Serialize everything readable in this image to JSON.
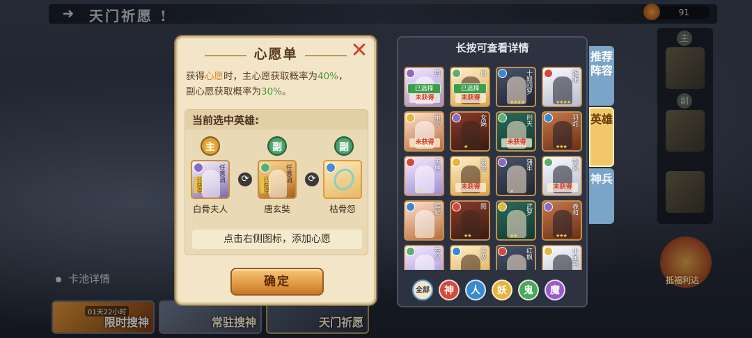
{
  "header": {
    "back_icon": "back-arrow-icon",
    "title": "天门祈愿 !",
    "currency_value": "91"
  },
  "pool_detail_label": "卡池详情",
  "bottom_tabs": [
    {
      "label": "限时搜神",
      "timer": "01天22小时"
    },
    {
      "label": "常驻搜神",
      "timer": ""
    },
    {
      "label": "天门祈愿",
      "timer": ""
    }
  ],
  "right_strip": {
    "badge_main": "主",
    "badge_sub": "副"
  },
  "treasure_label": "抵福利达",
  "wish_panel": {
    "title": "心愿单",
    "desc_line1_pre": "获得",
    "desc_line1_hl": "心愿",
    "desc_line1_mid": "时，主心愿获取概率为",
    "desc_line1_pct": "40%",
    "desc_line1_end": "，",
    "desc_line2_pre": "副心愿获取概率为",
    "desc_line2_pct": "30%",
    "desc_line2_end": "。",
    "selected_header": "当前选中英雄:",
    "slots": [
      {
        "role": "主",
        "name": "白骨夫人",
        "side_text": "任意消",
        "tag": "已获得"
      },
      {
        "role": "副",
        "name": "唐玄奘",
        "side_text": "任意消",
        "tag": "已获得"
      },
      {
        "role": "副",
        "name": "枯骨怨",
        "side_text": "",
        "tag": ""
      }
    ],
    "hint": "点击右侧图标，添加心愿",
    "confirm": "确定"
  },
  "hero_panel": {
    "title": "长按可查看详情",
    "cells": [
      {
        "name": "唐",
        "status": "已选择",
        "unowned": "未获得",
        "stars": ""
      },
      {
        "name": "白",
        "status": "已选择",
        "unowned": "未获得",
        "stars": ""
      },
      {
        "name": "十殿阎罗",
        "status": "",
        "unowned": "",
        "stars": "★★★★"
      },
      {
        "name": "嫦娥",
        "status": "",
        "unowned": "",
        "stars": "★★★★"
      },
      {
        "name": "蚩尤",
        "status": "",
        "unowned": "未获得",
        "stars": ""
      },
      {
        "name": "女娲",
        "status": "",
        "unowned": "",
        "stars": "★"
      },
      {
        "name": "刑天",
        "status": "",
        "unowned": "未获得",
        "stars": ""
      },
      {
        "name": "羽蛇",
        "status": "",
        "unowned": "",
        "stars": "★★★"
      },
      {
        "name": "天棒",
        "status": "",
        "unowned": "",
        "stars": "★"
      },
      {
        "name": "狻猊",
        "status": "",
        "unowned": "未获得",
        "stars": ""
      },
      {
        "name": "蒲牢",
        "status": "",
        "unowned": "",
        "stars": "★"
      },
      {
        "name": "嘲风",
        "status": "",
        "unowned": "未获得",
        "stars": ""
      },
      {
        "name": "睚眦",
        "status": "",
        "unowned": "",
        "stars": "★"
      },
      {
        "name": "图",
        "status": "",
        "unowned": "",
        "stars": "★★"
      },
      {
        "name": "武罗",
        "status": "",
        "unowned": "",
        "stars": "★★"
      },
      {
        "name": "羲和",
        "status": "",
        "unowned": "",
        "stars": "★★★"
      },
      {
        "name": "夸父",
        "status": "",
        "unowned": "",
        "stars": ""
      },
      {
        "name": "神农",
        "status": "",
        "unowned": "",
        "stars": ""
      },
      {
        "name": "红枫",
        "status": "",
        "unowned": "",
        "stars": ""
      },
      {
        "name": "小金乌",
        "status": "",
        "unowned": "",
        "stars": ""
      }
    ],
    "filters": [
      "全部",
      "神",
      "人",
      "妖",
      "鬼",
      "魔"
    ]
  },
  "side_tabs": [
    "推荐阵容",
    "英雄",
    "神兵"
  ],
  "colors": {
    "accent": "#e29c45",
    "selected_green": "#3e9c4c",
    "unowned_red": "#d63a2a"
  }
}
